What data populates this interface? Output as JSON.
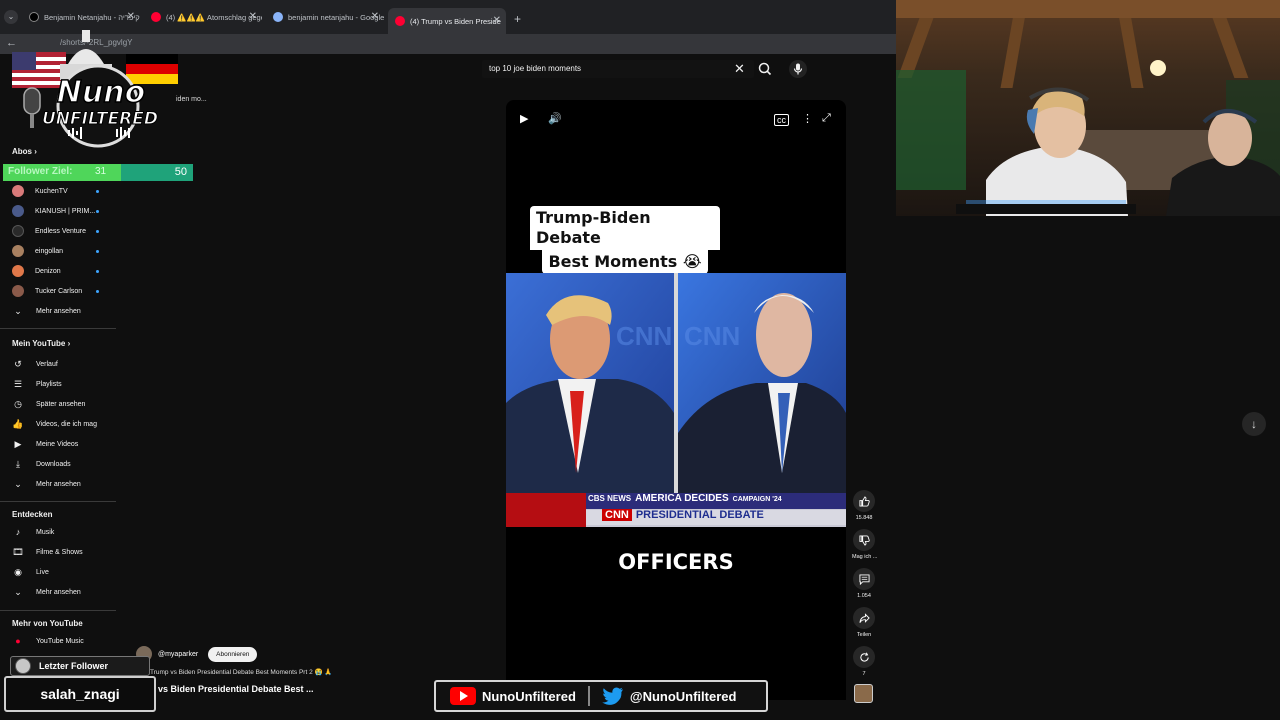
{
  "browser": {
    "tabs": [
      {
        "label": "Benjamin Netanjahu - ויקיפדיה",
        "icon": "x-favicon-icon",
        "active": false
      },
      {
        "label": "(4) ⚠️⚠️⚠️ Atomschlag gegen",
        "icon": "youtube-favicon-icon",
        "active": false
      },
      {
        "label": "benjamin netanjahu - Google S",
        "icon": "google-favicon-icon",
        "active": false
      },
      {
        "label": "(4) Trump vs Biden Preside",
        "icon": "youtube-favicon-icon",
        "active": true
      }
    ],
    "url": "/shorts/-2RL_pgvlgY"
  },
  "youtube": {
    "search": {
      "query": "top 10 joe biden moments"
    },
    "sidebar": {
      "hidden_history_snippet": "iden mo...",
      "abos_title": "Abos",
      "subscriptions": [
        {
          "label": "KuchenTV",
          "color": "#d97a7a"
        },
        {
          "label": "KIANUSH | PRIM...",
          "color": "#4a5a8a"
        },
        {
          "label": "Endless Venture",
          "color": "#2a2a2a"
        },
        {
          "label": "eingollan",
          "color": "#a88060"
        },
        {
          "label": "Denizon",
          "color": "#e0784a"
        },
        {
          "label": "Tucker Carlson",
          "color": "#8a5a4a"
        }
      ],
      "abos_more": "Mehr ansehen",
      "my_youtube_title": "Mein YouTube",
      "my_youtube": [
        {
          "label": "Verlauf",
          "icon": "history-icon",
          "glyph": "↺"
        },
        {
          "label": "Playlists",
          "icon": "playlists-icon",
          "glyph": "☰"
        },
        {
          "label": "Später ansehen",
          "icon": "watch-later-icon",
          "glyph": "◷"
        },
        {
          "label": "Videos, die ich mag",
          "icon": "thumbs-up-icon",
          "glyph": "👍"
        },
        {
          "label": "Meine Videos",
          "icon": "my-videos-icon",
          "glyph": "▶"
        },
        {
          "label": "Downloads",
          "icon": "download-icon",
          "glyph": "⤓"
        },
        {
          "label": "Mehr ansehen",
          "icon": "chevron-down-icon",
          "glyph": "⌄"
        }
      ],
      "explore_title": "Entdecken",
      "explore": [
        {
          "label": "Musik",
          "icon": "music-icon",
          "glyph": "♪"
        },
        {
          "label": "Filme & Shows",
          "icon": "film-icon",
          "glyph": "🎞"
        },
        {
          "label": "Live",
          "icon": "live-icon",
          "glyph": "◉"
        },
        {
          "label": "Mehr ansehen",
          "icon": "chevron-down-icon",
          "glyph": "⌄"
        }
      ],
      "more_title": "Mehr von YouTube",
      "more": [
        {
          "label": "YouTube Music",
          "icon": "youtube-music-icon",
          "glyph": "●"
        }
      ]
    },
    "short": {
      "caption_line1": "Trump-Biden Debate",
      "caption_line2": "Best Moments 😭",
      "subtitle": "OFFICERS",
      "cbs_text": "CBS NEWS",
      "america_decides": "AMERICA DECIDES",
      "campaign": "CAMPAIGN '24",
      "cnn": "CNN",
      "presidential_debate": "PRESIDENTIAL DEBATE",
      "channel": "@myaparker",
      "subscribe": "Abonnieren",
      "title_small": "Trump vs Biden Presidential Debate Best Moments Prt 2 😭 🙏",
      "title_large": "p vs Biden Presidential Debate Best ...",
      "actions": [
        {
          "name": "like-button",
          "icon": "thumbs-up-icon",
          "glyph": "👍",
          "count": "15.848"
        },
        {
          "name": "dislike-button",
          "icon": "thumbs-down-icon",
          "glyph": "👎",
          "count": "Mag ich ..."
        },
        {
          "name": "comments-button",
          "icon": "comment-icon",
          "glyph": "▤",
          "count": "1.054"
        },
        {
          "name": "share-button",
          "icon": "share-icon",
          "glyph": "➦",
          "count": "Teilen"
        },
        {
          "name": "remix-button",
          "icon": "remix-icon",
          "glyph": "↻",
          "count": "7"
        }
      ]
    }
  },
  "overlay": {
    "logo_line1": "Nuno",
    "logo_line2": "UNFILTERED",
    "follower_goal": {
      "label": "Follower Ziel:",
      "current": "31",
      "goal": "50",
      "progress": 0.62
    },
    "last_follower_label": "Letzter Follower",
    "last_follower_name": "salah_znagi",
    "youtube_handle": "NunoUnfiltered",
    "twitter_handle": "@NunoUnfiltered"
  },
  "colors": {
    "accent": "#ff0033",
    "follower_bar": "#4fd65a",
    "subscribed_dot": "#3ea6ff"
  }
}
